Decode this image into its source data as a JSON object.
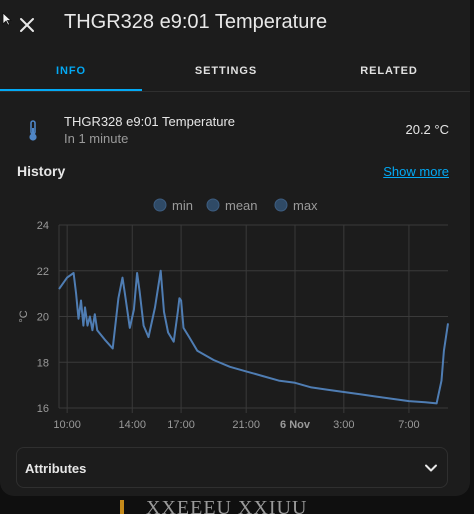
{
  "dialog": {
    "title": "THGR328 e9:01 Temperature",
    "close_icon": "close-icon"
  },
  "tabs": [
    {
      "label": "INFO",
      "active": true
    },
    {
      "label": "SETTINGS",
      "active": false
    },
    {
      "label": "RELATED",
      "active": false
    }
  ],
  "entity": {
    "icon": "thermometer-icon",
    "name": "THGR328 e9:01 Temperature",
    "last_changed": "In 1 minute",
    "state": "20.2 °C"
  },
  "history": {
    "title": "History",
    "show_more": "Show more"
  },
  "chart_data": {
    "type": "line",
    "legend": [
      {
        "label": "min"
      },
      {
        "label": "mean"
      },
      {
        "label": "max"
      }
    ],
    "ylabel": "°C",
    "ylim": [
      16,
      24
    ],
    "y_ticks": [
      "24",
      "22",
      "20",
      "18",
      "16"
    ],
    "x_ticks": [
      "10:00",
      "14:00",
      "17:00",
      "21:00",
      "6 Nov",
      "3:00",
      "7:00"
    ],
    "x_tick_hours": [
      10,
      14,
      17,
      21,
      24,
      27,
      31
    ],
    "xlim_hours": [
      9.5,
      33.4
    ],
    "grid": true,
    "colors": {
      "series": "#4f7db3",
      "legend_fill": "#2f4a66",
      "grid": "#3a3a3a"
    },
    "series": [
      {
        "values": [
          [
            9.5,
            21.2
          ],
          [
            10.0,
            21.7
          ],
          [
            10.4,
            21.9
          ],
          [
            10.55,
            21.0
          ],
          [
            10.7,
            19.9
          ],
          [
            10.85,
            20.7
          ],
          [
            11.0,
            19.6
          ],
          [
            11.1,
            20.4
          ],
          [
            11.25,
            19.6
          ],
          [
            11.4,
            20.0
          ],
          [
            11.55,
            19.4
          ],
          [
            11.7,
            20.1
          ],
          [
            11.85,
            19.4
          ],
          [
            12.3,
            19.0
          ],
          [
            12.8,
            18.6
          ],
          [
            13.15,
            20.8
          ],
          [
            13.4,
            21.7
          ],
          [
            13.55,
            21.0
          ],
          [
            13.85,
            19.5
          ],
          [
            14.1,
            20.3
          ],
          [
            14.3,
            21.9
          ],
          [
            14.45,
            21.1
          ],
          [
            14.7,
            19.6
          ],
          [
            15.0,
            19.1
          ],
          [
            15.4,
            20.4
          ],
          [
            15.75,
            22.0
          ],
          [
            15.95,
            20.2
          ],
          [
            16.2,
            19.3
          ],
          [
            16.55,
            18.9
          ],
          [
            16.8,
            20.2
          ],
          [
            16.9,
            20.8
          ],
          [
            17.0,
            20.7
          ],
          [
            17.15,
            19.5
          ],
          [
            17.5,
            19.1
          ],
          [
            18.0,
            18.5
          ],
          [
            19.0,
            18.1
          ],
          [
            20.0,
            17.8
          ],
          [
            21.0,
            17.6
          ],
          [
            22.0,
            17.4
          ],
          [
            23.0,
            17.2
          ],
          [
            24.0,
            17.1
          ],
          [
            25.0,
            16.9
          ],
          [
            26.0,
            16.8
          ],
          [
            27.0,
            16.7
          ],
          [
            28.0,
            16.6
          ],
          [
            29.0,
            16.5
          ],
          [
            30.0,
            16.4
          ],
          [
            31.0,
            16.3
          ],
          [
            32.0,
            16.25
          ],
          [
            32.7,
            16.2
          ],
          [
            33.0,
            17.2
          ],
          [
            33.15,
            18.5
          ],
          [
            33.4,
            19.7
          ]
        ]
      }
    ]
  },
  "attributes": {
    "label": "Attributes",
    "chevron_icon": "chevron-down-icon"
  },
  "background": {
    "partial_text": "XXEEEU XXIUU"
  }
}
